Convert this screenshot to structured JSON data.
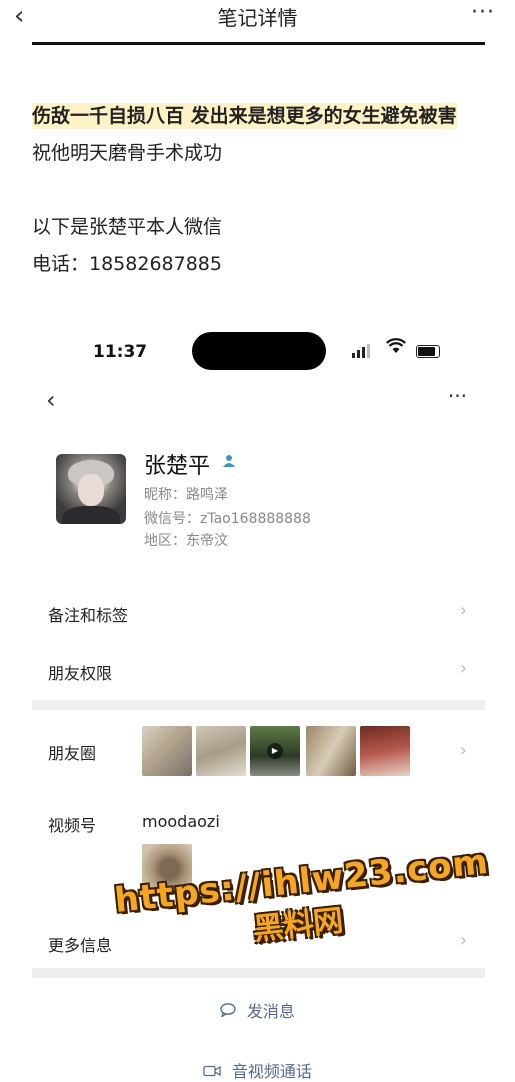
{
  "topbar": {
    "back": "‹",
    "title": "笔记详情",
    "more": "···"
  },
  "post": {
    "headline": "伤敌一千自损八百 发出来是想更多的女生避免被害",
    "line2": "祝他明天磨骨手术成功",
    "line3": "以下是张楚平本人微信",
    "line4": "电话：18582687885"
  },
  "status": {
    "time": "11:37"
  },
  "wechat": {
    "back": "‹",
    "more": "···",
    "name": "张楚平",
    "nickname": "昵称：路鸣泽",
    "wechat_id": "微信号：zTao168888888",
    "region": "地区：东帝汶",
    "rows": {
      "remarks": "备注和标签",
      "permissions": "朋友权限",
      "moments": "朋友圈",
      "channels": "视频号",
      "more_info": "更多信息"
    },
    "channels_name": "moodaozi",
    "send_message": "发消息",
    "av_call": "音视频通话"
  },
  "watermark": {
    "url": "https://ihlw23.com",
    "name": "黑料网"
  }
}
